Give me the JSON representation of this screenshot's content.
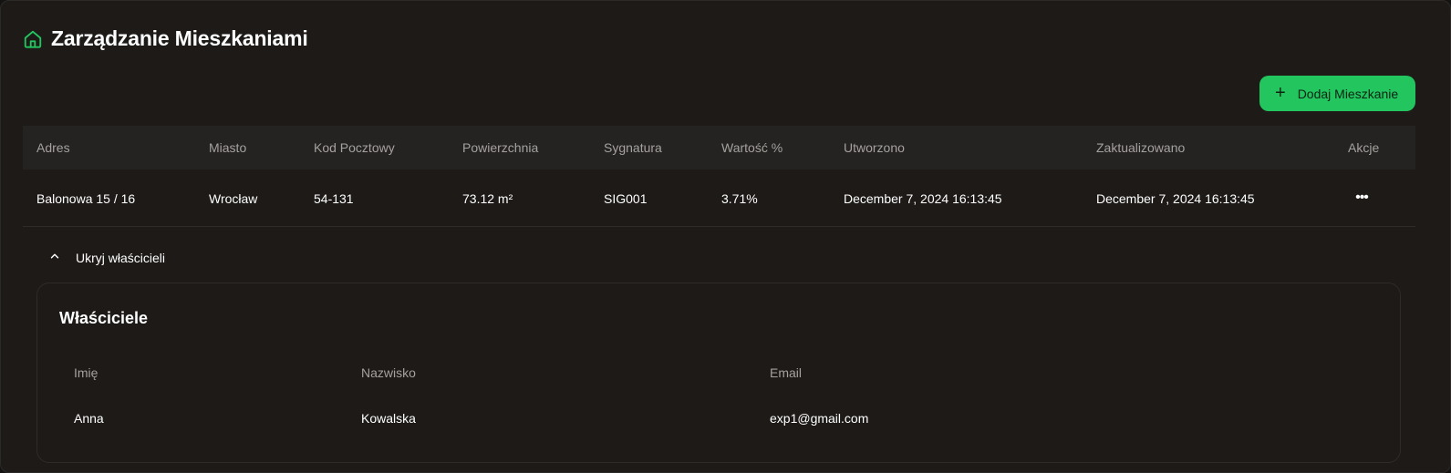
{
  "header": {
    "title": "Zarządzanie Mieszkaniami",
    "icon": "home-icon",
    "icon_color": "#22c55e"
  },
  "toolbar": {
    "add_icon": "plus-icon",
    "add_symbol": "+",
    "add_label": "Dodaj Mieszkanie",
    "add_color": "#22c55e"
  },
  "table": {
    "columns": [
      "Adres",
      "Miasto",
      "Kod Pocztowy",
      "Powierzchnia",
      "Sygnatura",
      "Wartość %",
      "Utworzono",
      "Zaktualizowano",
      "Akcje"
    ],
    "rows": [
      {
        "cells": [
          "Balonowa 15 / 16",
          "Wrocław",
          "54-131",
          "73.12 m²",
          "SIG001",
          "3.71%",
          "December 7, 2024 16:13:45",
          "December 7, 2024 16:13:45"
        ],
        "actions_icon": "more-horizontal-icon",
        "actions_symbol": "•••"
      }
    ]
  },
  "owners": {
    "toggle_label": "Ukryj właścicieli",
    "toggle_icon": "chevron-up-icon",
    "title": "Właściciele",
    "columns": [
      "Imię",
      "Nazwisko",
      "Email"
    ],
    "rows": [
      [
        "Anna",
        "Kowalska",
        "exp1@gmail.com"
      ]
    ]
  }
}
